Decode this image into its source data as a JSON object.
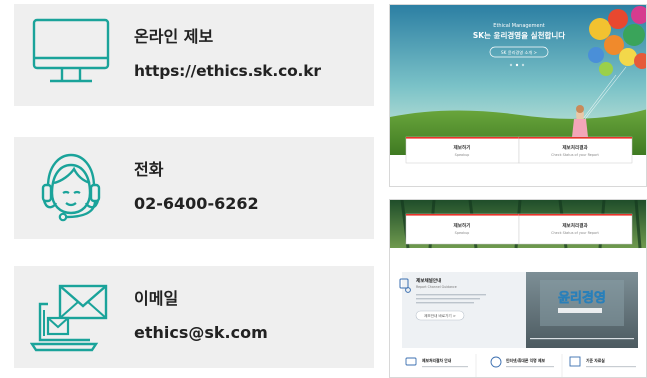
{
  "cards": [
    {
      "label": "온라인 제보",
      "value": "https://ethics.sk.co.kr",
      "icon": "monitor-icon"
    },
    {
      "label": "전화",
      "value": "02-6400-6262",
      "icon": "headset-icon"
    },
    {
      "label": "이메일",
      "value": "ethics@sk.com",
      "icon": "email-laptop-icon"
    }
  ],
  "shot1": {
    "kicker": "Ethical Management",
    "headline": "SK는 윤리경영을 실천합니다",
    "button": "SK 윤리경영 소개  >",
    "boxes": [
      {
        "title": "제보하기",
        "sub": "Speakup"
      },
      {
        "title": "제보처리결과",
        "sub": "Check Status of your Report"
      }
    ]
  },
  "shot2": {
    "boxes": [
      {
        "title": "제보하기",
        "sub": "Speakup"
      },
      {
        "title": "제보처리결과",
        "sub": "Check Status of your Report"
      }
    ],
    "panel": {
      "title": "제보채널안내",
      "sub": "Report Channel Guidance",
      "button": "제보안내 바로가기  >"
    },
    "video_text": "윤리경영",
    "bottom": [
      "제보처리절차 안내",
      "인터넷/휴대폰 익명 제보",
      "기준 자료실"
    ]
  },
  "colors": {
    "teal": "#1aa39a",
    "card_bg": "#efefef",
    "red": "#e8332a"
  }
}
